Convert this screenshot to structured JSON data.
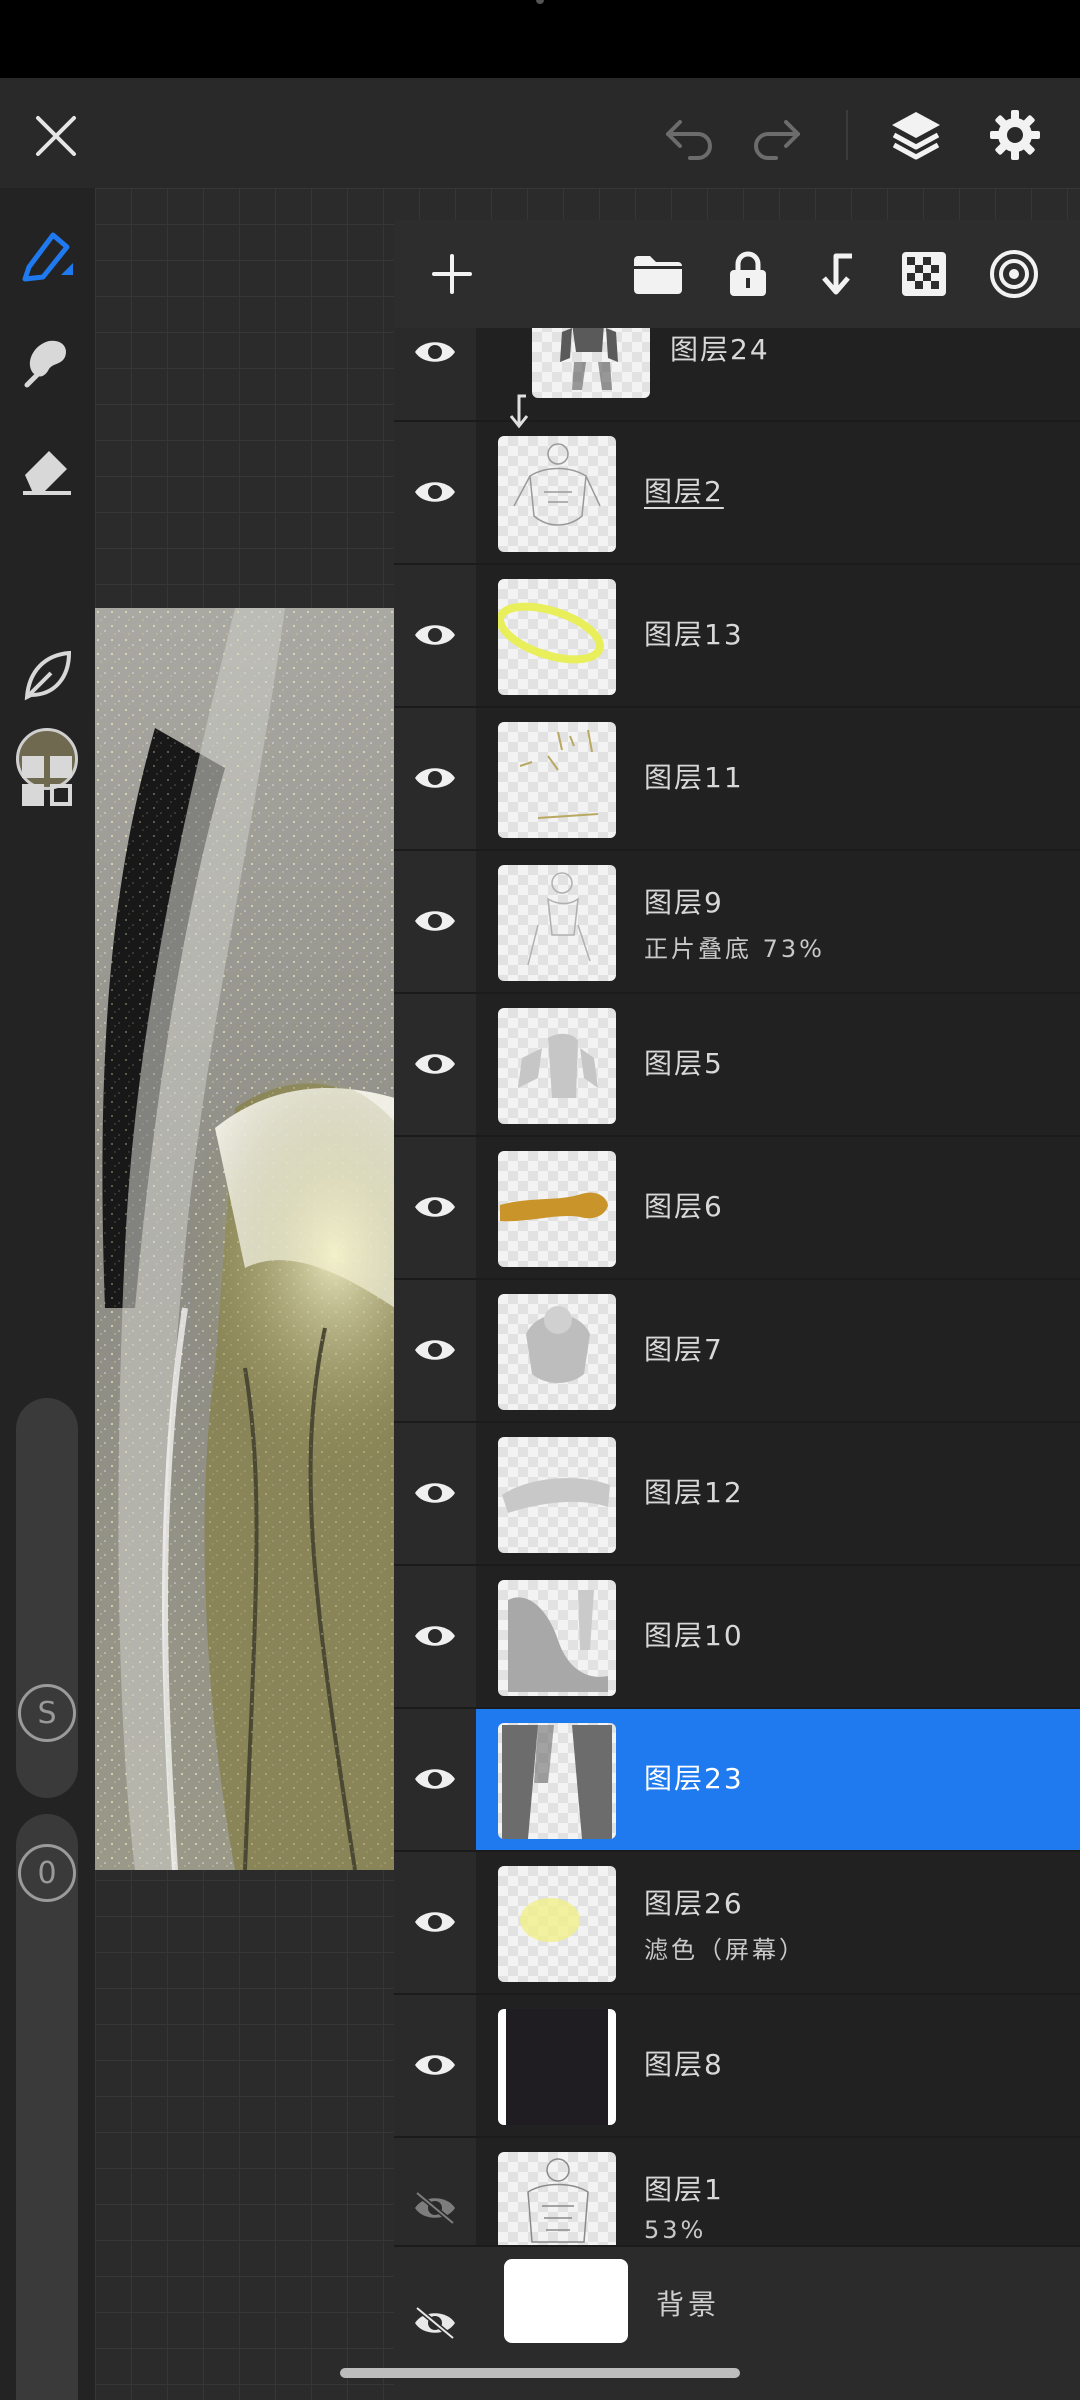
{
  "toolbar": {
    "close": "close-icon",
    "undo": "undo-icon",
    "redo": "redo-icon",
    "layers": "layers-icon",
    "settings": "gear-icon"
  },
  "left_tools": {
    "brush": "pen-icon",
    "smudge": "smudge-icon",
    "eraser": "eraser-icon",
    "color": "#6f6a4f",
    "lasso": "leaf-icon",
    "gallery": "grid-icon",
    "size_knob": "S",
    "opacity_knob": "0"
  },
  "layers_header": {
    "add": "plus-icon",
    "group": "folder-icon",
    "lock": "lock-icon",
    "clip": "clip-arrow-icon",
    "alpha": "checker-icon",
    "blend": "target-icon"
  },
  "layers": [
    {
      "name": "图层24",
      "sub": "",
      "visible": true,
      "clipped": true
    },
    {
      "name": "图层2",
      "sub": "",
      "visible": true,
      "underline": true
    },
    {
      "name": "图层13",
      "sub": "",
      "visible": true
    },
    {
      "name": "图层11",
      "sub": "",
      "visible": true
    },
    {
      "name": "图层9",
      "sub": "正片叠底  73%",
      "visible": true
    },
    {
      "name": "图层5",
      "sub": "",
      "visible": true
    },
    {
      "name": "图层6",
      "sub": "",
      "visible": true
    },
    {
      "name": "图层7",
      "sub": "",
      "visible": true
    },
    {
      "name": "图层12",
      "sub": "",
      "visible": true
    },
    {
      "name": "图层10",
      "sub": "",
      "visible": true
    },
    {
      "name": "图层23",
      "sub": "",
      "visible": true,
      "selected": true
    },
    {
      "name": "图层26",
      "sub": "滤色（屏幕）",
      "visible": true
    },
    {
      "name": "图层8",
      "sub": "",
      "visible": true
    },
    {
      "name": "图层1",
      "sub": "53%",
      "visible": false
    }
  ],
  "background_layer": {
    "name": "背景",
    "visible": false
  },
  "accent_color": "#1f7af0"
}
